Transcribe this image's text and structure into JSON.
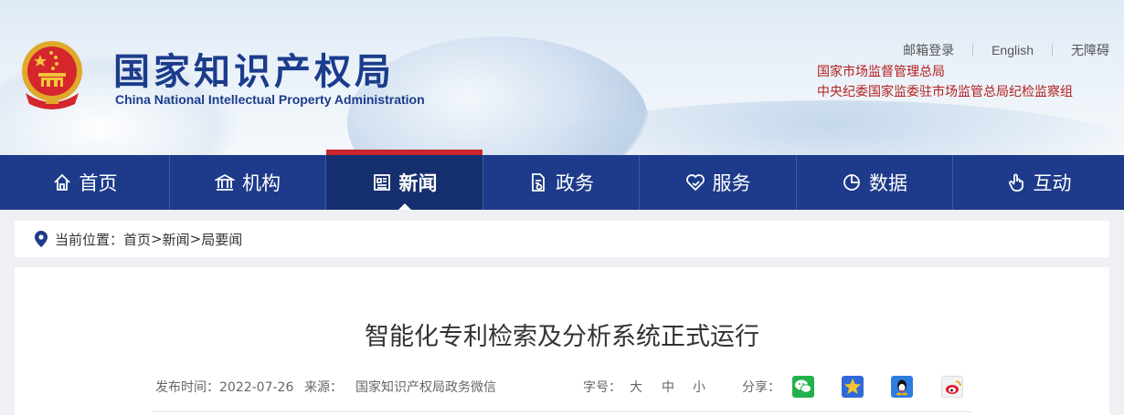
{
  "header": {
    "logo_cn": "国家知识产权局",
    "logo_en": "China National Intellectual Property Administration",
    "top_links": [
      "邮箱登录",
      "English",
      "无障碍"
    ],
    "orgs": [
      "国家市场监督管理总局",
      "中央纪委国家监委驻市场监管总局纪检监察组"
    ]
  },
  "nav": {
    "items": [
      {
        "label": "首页",
        "icon": "home-icon"
      },
      {
        "label": "机构",
        "icon": "institution-icon"
      },
      {
        "label": "新闻",
        "icon": "news-icon"
      },
      {
        "label": "政务",
        "icon": "document-icon"
      },
      {
        "label": "服务",
        "icon": "heart-hand-icon"
      },
      {
        "label": "数据",
        "icon": "pie-chart-icon"
      },
      {
        "label": "互动",
        "icon": "hand-pointer-icon"
      }
    ],
    "active_index": 2
  },
  "breadcrumb": {
    "prefix": "当前位置：",
    "items": [
      "首页",
      "新闻",
      "局要闻"
    ],
    "separator": ">"
  },
  "article": {
    "title": "智能化专利检索及分析系统正式运行",
    "published_label": "发布时间：2022-07-26",
    "source_label": "来源：",
    "source": "国家知识产权局政务微信",
    "font_size_label": "字号：",
    "font_sizes": [
      "大",
      "中",
      "小"
    ],
    "share_label": "分享：",
    "share_targets": [
      "wechat-icon",
      "star-icon",
      "qq-icon",
      "weibo-icon"
    ]
  },
  "colors": {
    "nav_bg": "#1d3b8a",
    "nav_active": "#16306f",
    "accent_red": "#c8252c",
    "logo_blue": "#1b3c8c",
    "org_red": "#b21e1e"
  }
}
